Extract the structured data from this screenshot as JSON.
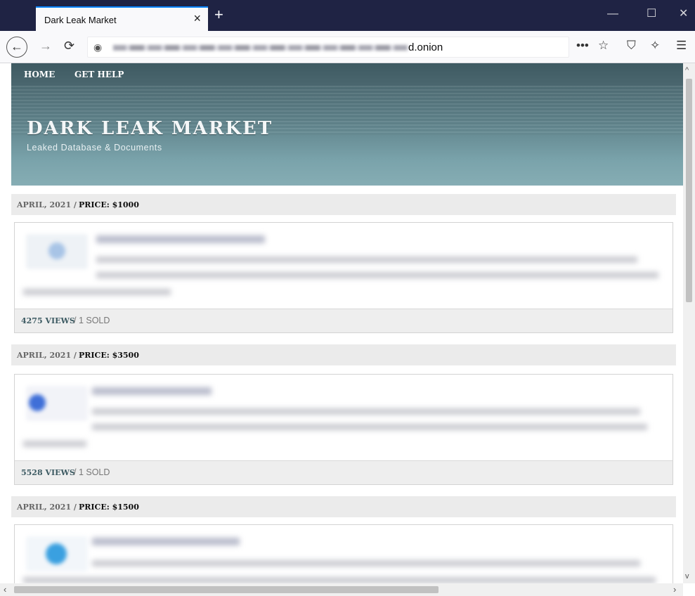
{
  "browser": {
    "tab_title": "Dark Leak Market",
    "tab_close": "×",
    "new_tab": "+",
    "url_suffix": "d.onion",
    "win_minimize": "—",
    "win_maximize": "☐",
    "win_close": "✕"
  },
  "site": {
    "nav": [
      {
        "label": "HOME"
      },
      {
        "label": "GET HELP"
      }
    ],
    "title": "DARK LEAK MARKET",
    "subtitle": "Leaked Database & Documents"
  },
  "listings": [
    {
      "date": "APRIL, 2021 /",
      "price": "PRICE: $1000",
      "views": "4275 VIEWS",
      "sold": "/ 1 SOLD",
      "icon_color": "#a8c4e6"
    },
    {
      "date": "APRIL, 2021 /",
      "price": "PRICE: $3500",
      "views": "5528 VIEWS",
      "sold": "/ 1 SOLD",
      "icon_color": "#3f6fd8"
    },
    {
      "date": "APRIL, 2021 /",
      "price": "PRICE: $1500",
      "views": "",
      "sold": "",
      "icon_color": "#3aa0e0"
    }
  ],
  "colors": {
    "nav_bg": "#44616a",
    "hero_bg": "#7aa3ab",
    "views_text": "#3c5a62"
  }
}
